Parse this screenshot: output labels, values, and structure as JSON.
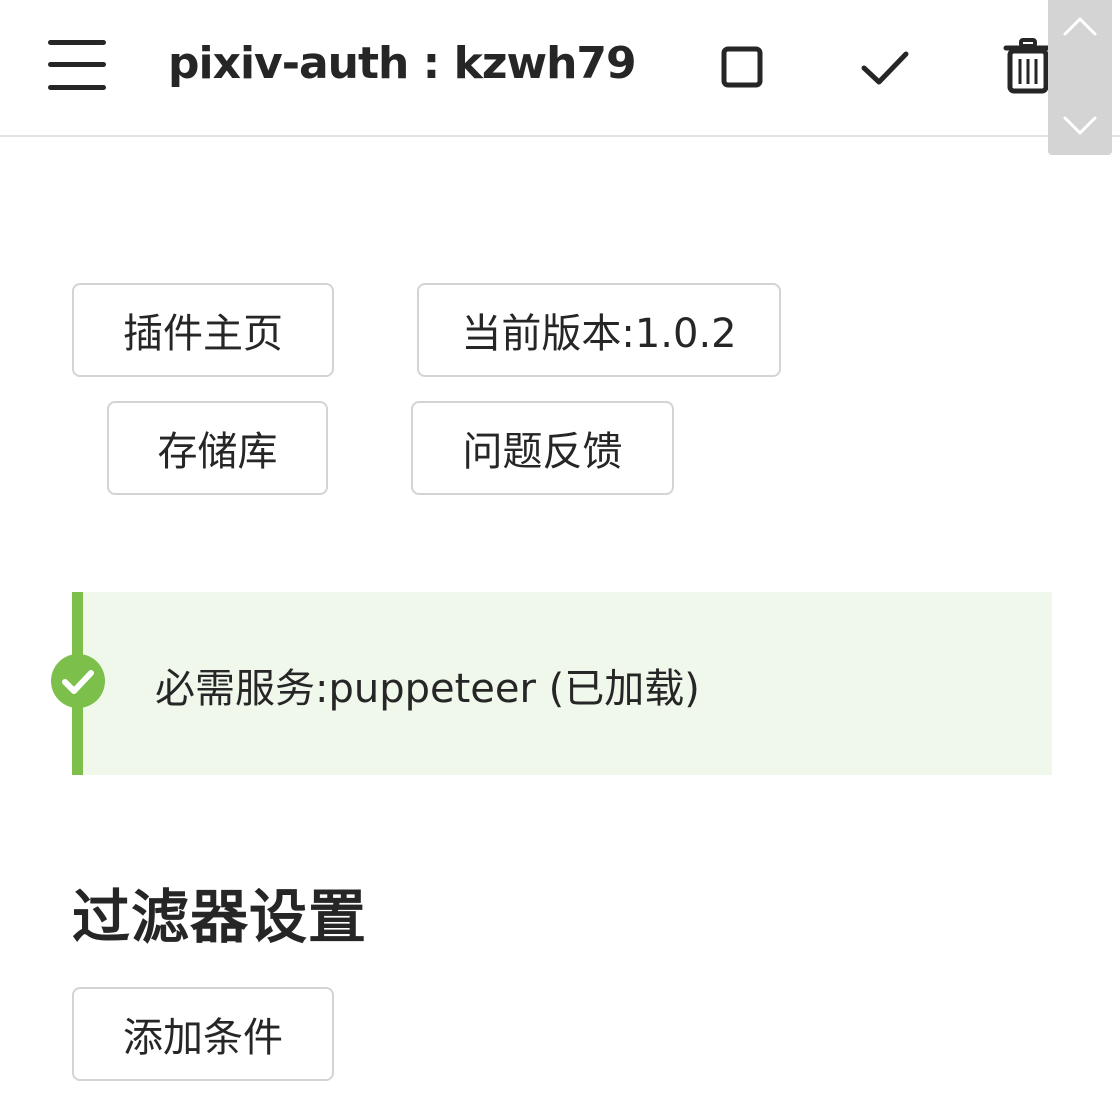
{
  "header": {
    "title": "pixiv-auth : kzwh79",
    "menu_icon": "hamburger-menu-icon",
    "actions": [
      "square-icon",
      "checkmark-icon",
      "trash-icon"
    ]
  },
  "scroll_controls": {
    "up_icon": "chevron-up-icon",
    "down_icon": "chevron-down-icon"
  },
  "links": {
    "home": "插件主页",
    "version": "当前版本:1.0.2",
    "repository": "存储库",
    "feedback": "问题反馈"
  },
  "notice": {
    "icon": "check-circle-icon",
    "text": "必需服务:puppeteer (已加载)",
    "accent_color": "#7cbf4b",
    "background_color": "#f0f8ec"
  },
  "filter_section": {
    "title": "过滤器设置",
    "add_condition_label": "添加条件"
  }
}
